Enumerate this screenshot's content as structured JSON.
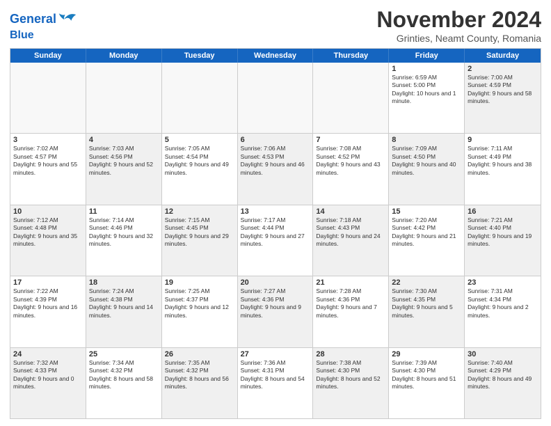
{
  "header": {
    "logo_line1": "General",
    "logo_line2": "Blue",
    "title": "November 2024",
    "subtitle": "Grinties, Neamt County, Romania"
  },
  "weekdays": [
    "Sunday",
    "Monday",
    "Tuesday",
    "Wednesday",
    "Thursday",
    "Friday",
    "Saturday"
  ],
  "rows": [
    [
      {
        "day": "",
        "info": "",
        "shaded": true
      },
      {
        "day": "",
        "info": "",
        "shaded": true
      },
      {
        "day": "",
        "info": "",
        "shaded": true
      },
      {
        "day": "",
        "info": "",
        "shaded": true
      },
      {
        "day": "",
        "info": "",
        "shaded": true
      },
      {
        "day": "1",
        "info": "Sunrise: 6:59 AM\nSunset: 5:00 PM\nDaylight: 10 hours and 1 minute.",
        "shaded": false
      },
      {
        "day": "2",
        "info": "Sunrise: 7:00 AM\nSunset: 4:59 PM\nDaylight: 9 hours and 58 minutes.",
        "shaded": true
      }
    ],
    [
      {
        "day": "3",
        "info": "Sunrise: 7:02 AM\nSunset: 4:57 PM\nDaylight: 9 hours and 55 minutes.",
        "shaded": false
      },
      {
        "day": "4",
        "info": "Sunrise: 7:03 AM\nSunset: 4:56 PM\nDaylight: 9 hours and 52 minutes.",
        "shaded": true
      },
      {
        "day": "5",
        "info": "Sunrise: 7:05 AM\nSunset: 4:54 PM\nDaylight: 9 hours and 49 minutes.",
        "shaded": false
      },
      {
        "day": "6",
        "info": "Sunrise: 7:06 AM\nSunset: 4:53 PM\nDaylight: 9 hours and 46 minutes.",
        "shaded": true
      },
      {
        "day": "7",
        "info": "Sunrise: 7:08 AM\nSunset: 4:52 PM\nDaylight: 9 hours and 43 minutes.",
        "shaded": false
      },
      {
        "day": "8",
        "info": "Sunrise: 7:09 AM\nSunset: 4:50 PM\nDaylight: 9 hours and 40 minutes.",
        "shaded": true
      },
      {
        "day": "9",
        "info": "Sunrise: 7:11 AM\nSunset: 4:49 PM\nDaylight: 9 hours and 38 minutes.",
        "shaded": false
      }
    ],
    [
      {
        "day": "10",
        "info": "Sunrise: 7:12 AM\nSunset: 4:48 PM\nDaylight: 9 hours and 35 minutes.",
        "shaded": true
      },
      {
        "day": "11",
        "info": "Sunrise: 7:14 AM\nSunset: 4:46 PM\nDaylight: 9 hours and 32 minutes.",
        "shaded": false
      },
      {
        "day": "12",
        "info": "Sunrise: 7:15 AM\nSunset: 4:45 PM\nDaylight: 9 hours and 29 minutes.",
        "shaded": true
      },
      {
        "day": "13",
        "info": "Sunrise: 7:17 AM\nSunset: 4:44 PM\nDaylight: 9 hours and 27 minutes.",
        "shaded": false
      },
      {
        "day": "14",
        "info": "Sunrise: 7:18 AM\nSunset: 4:43 PM\nDaylight: 9 hours and 24 minutes.",
        "shaded": true
      },
      {
        "day": "15",
        "info": "Sunrise: 7:20 AM\nSunset: 4:42 PM\nDaylight: 9 hours and 21 minutes.",
        "shaded": false
      },
      {
        "day": "16",
        "info": "Sunrise: 7:21 AM\nSunset: 4:40 PM\nDaylight: 9 hours and 19 minutes.",
        "shaded": true
      }
    ],
    [
      {
        "day": "17",
        "info": "Sunrise: 7:22 AM\nSunset: 4:39 PM\nDaylight: 9 hours and 16 minutes.",
        "shaded": false
      },
      {
        "day": "18",
        "info": "Sunrise: 7:24 AM\nSunset: 4:38 PM\nDaylight: 9 hours and 14 minutes.",
        "shaded": true
      },
      {
        "day": "19",
        "info": "Sunrise: 7:25 AM\nSunset: 4:37 PM\nDaylight: 9 hours and 12 minutes.",
        "shaded": false
      },
      {
        "day": "20",
        "info": "Sunrise: 7:27 AM\nSunset: 4:36 PM\nDaylight: 9 hours and 9 minutes.",
        "shaded": true
      },
      {
        "day": "21",
        "info": "Sunrise: 7:28 AM\nSunset: 4:36 PM\nDaylight: 9 hours and 7 minutes.",
        "shaded": false
      },
      {
        "day": "22",
        "info": "Sunrise: 7:30 AM\nSunset: 4:35 PM\nDaylight: 9 hours and 5 minutes.",
        "shaded": true
      },
      {
        "day": "23",
        "info": "Sunrise: 7:31 AM\nSunset: 4:34 PM\nDaylight: 9 hours and 2 minutes.",
        "shaded": false
      }
    ],
    [
      {
        "day": "24",
        "info": "Sunrise: 7:32 AM\nSunset: 4:33 PM\nDaylight: 9 hours and 0 minutes.",
        "shaded": true
      },
      {
        "day": "25",
        "info": "Sunrise: 7:34 AM\nSunset: 4:32 PM\nDaylight: 8 hours and 58 minutes.",
        "shaded": false
      },
      {
        "day": "26",
        "info": "Sunrise: 7:35 AM\nSunset: 4:32 PM\nDaylight: 8 hours and 56 minutes.",
        "shaded": true
      },
      {
        "day": "27",
        "info": "Sunrise: 7:36 AM\nSunset: 4:31 PM\nDaylight: 8 hours and 54 minutes.",
        "shaded": false
      },
      {
        "day": "28",
        "info": "Sunrise: 7:38 AM\nSunset: 4:30 PM\nDaylight: 8 hours and 52 minutes.",
        "shaded": true
      },
      {
        "day": "29",
        "info": "Sunrise: 7:39 AM\nSunset: 4:30 PM\nDaylight: 8 hours and 51 minutes.",
        "shaded": false
      },
      {
        "day": "30",
        "info": "Sunrise: 7:40 AM\nSunset: 4:29 PM\nDaylight: 8 hours and 49 minutes.",
        "shaded": true
      }
    ]
  ]
}
